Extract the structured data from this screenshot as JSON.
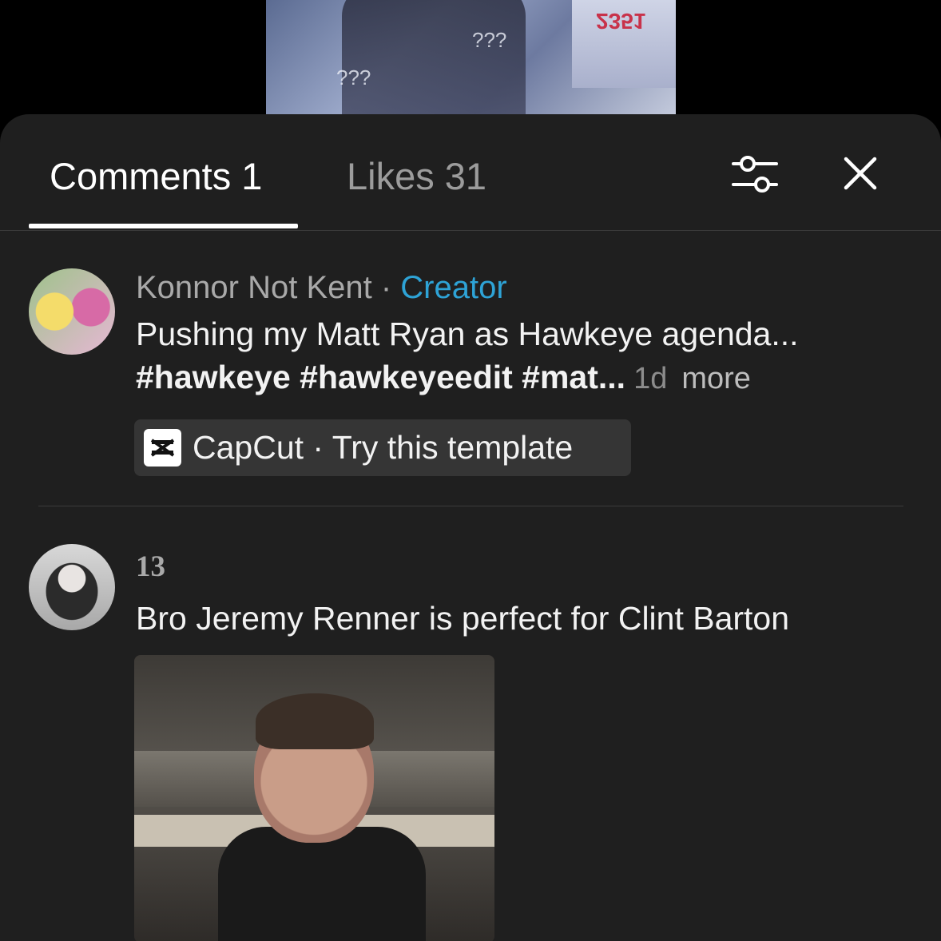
{
  "video_preview": {
    "sign_text": "2351",
    "overlay_text": "???"
  },
  "tabs": {
    "comments_label": "Comments 1",
    "likes_label": "Likes 31"
  },
  "icons": {
    "filter": "sliders-icon",
    "close": "close-icon",
    "capcut": "capcut-logo-icon"
  },
  "colors": {
    "sheet_bg": "#1f1f1f",
    "creator_accent": "#2ea3d6",
    "text_primary": "#f2f2f2",
    "text_secondary": "#a9a9a9"
  },
  "creator_post": {
    "author": "Konnor Not Kent",
    "separator": " · ",
    "badge": "Creator",
    "caption_line1": "Pushing my Matt Ryan as Hawkeye agenda...",
    "caption_line2_tags": "#hawkeye #hawkeyeedit #mat...",
    "age": "1d",
    "more_label": "more",
    "template_chip": "CapCut · Try this template"
  },
  "comments": [
    {
      "author": "13",
      "text": "Bro Jeremy Renner is perfect for Clint Barton"
    }
  ]
}
